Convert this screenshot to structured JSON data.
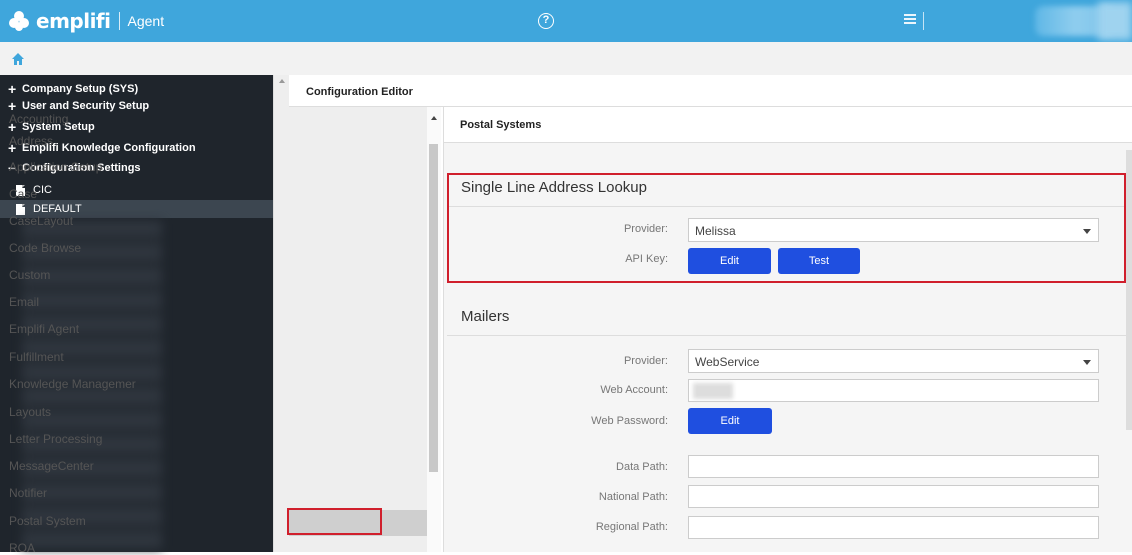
{
  "app": {
    "brand": "emplifi",
    "product": "Agent"
  },
  "nav": {
    "items": [
      {
        "symbol": "+",
        "label": "Company Setup (SYS)"
      },
      {
        "symbol": "+",
        "label": "User and Security Setup"
      },
      {
        "symbol": "+",
        "label": "System Setup"
      },
      {
        "symbol": "+",
        "label": "Emplifi Knowledge Configuration"
      },
      {
        "symbol": "−",
        "label": "Configuration Settings"
      }
    ],
    "children": [
      {
        "label": "CIC",
        "active": false
      },
      {
        "label": "DEFAULT",
        "active": true
      }
    ]
  },
  "editor": {
    "title": "Configuration Editor",
    "categories": [
      "Accounting",
      "Address",
      "Application Setup",
      "Case",
      "CaseLayout",
      "Code Browse",
      "Custom",
      "Email",
      "Emplifi Agent",
      "Fulfillment",
      "Knowledge Managemer",
      "Layouts",
      "Letter Processing",
      "MessageCenter",
      "Notifier",
      "Postal System",
      "ROA"
    ],
    "selected_category": "Postal System"
  },
  "panel": {
    "title": "Postal Systems",
    "single_line": {
      "title": "Single Line Address Lookup",
      "provider_label": "Provider:",
      "provider_value": "Melissa",
      "api_key_label": "API Key:",
      "edit_label": "Edit",
      "test_label": "Test"
    },
    "mailers": {
      "title": "Mailers",
      "provider_label": "Provider:",
      "provider_value": "WebService",
      "web_account_label": "Web Account:",
      "web_password_label": "Web Password:",
      "edit_label": "Edit",
      "data_path_label": "Data Path:",
      "national_path_label": "National Path:",
      "regional_path_label": "Regional Path:"
    }
  },
  "colors": {
    "topbar": "#3fa6dc",
    "nav_bg": "#1f252c",
    "button": "#1f4fe0",
    "highlight": "#d01f2c"
  }
}
